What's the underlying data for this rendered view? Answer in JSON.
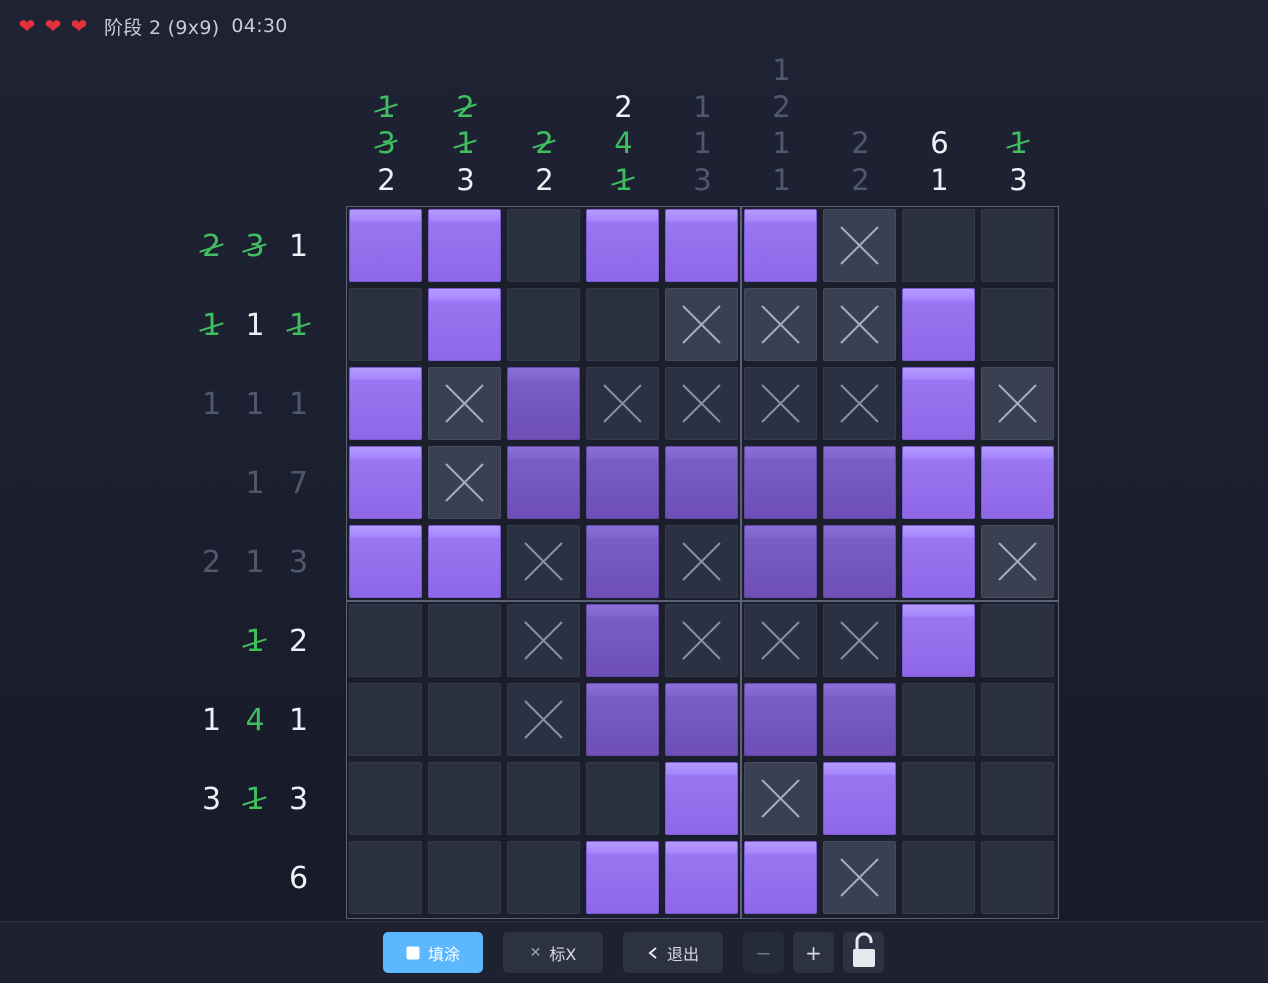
{
  "header": {
    "lives": 3,
    "stage_label": "阶段 2 (9x9)",
    "timer": "04:30"
  },
  "colors": {
    "accent": "#5bb8ff",
    "fill": "#9a76f2",
    "heart": "#e5313b",
    "done_clue": "#3fbf5f"
  },
  "col_clues": [
    [
      {
        "v": "1",
        "s": "done"
      },
      {
        "v": "3",
        "s": "done"
      },
      {
        "v": "2",
        "s": "active"
      }
    ],
    [
      {
        "v": "2",
        "s": "done"
      },
      {
        "v": "1",
        "s": "done"
      },
      {
        "v": "3",
        "s": "active"
      }
    ],
    [
      {
        "v": "2",
        "s": "done"
      },
      {
        "v": "2",
        "s": "active"
      }
    ],
    [
      {
        "v": "2",
        "s": "active"
      },
      {
        "v": "4",
        "s": "green"
      },
      {
        "v": "1",
        "s": "done"
      }
    ],
    [
      {
        "v": "1",
        "s": "dim"
      },
      {
        "v": "1",
        "s": "dim"
      },
      {
        "v": "3",
        "s": "dim"
      }
    ],
    [
      {
        "v": "1",
        "s": "dim"
      },
      {
        "v": "2",
        "s": "dim"
      },
      {
        "v": "1",
        "s": "dim"
      },
      {
        "v": "1",
        "s": "dim"
      }
    ],
    [
      {
        "v": "2",
        "s": "dim"
      },
      {
        "v": "2",
        "s": "dim"
      }
    ],
    [
      {
        "v": "6",
        "s": "active"
      },
      {
        "v": "1",
        "s": "active"
      }
    ],
    [
      {
        "v": "1",
        "s": "done"
      },
      {
        "v": "3",
        "s": "active"
      }
    ]
  ],
  "row_clues": [
    [
      {
        "v": "2",
        "s": "done"
      },
      {
        "v": "3",
        "s": "done"
      },
      {
        "v": "1",
        "s": "active"
      }
    ],
    [
      {
        "v": "1",
        "s": "done"
      },
      {
        "v": "1",
        "s": "active"
      },
      {
        "v": "1",
        "s": "done"
      }
    ],
    [
      {
        "v": "1",
        "s": "dim"
      },
      {
        "v": "1",
        "s": "dim"
      },
      {
        "v": "1",
        "s": "dim"
      }
    ],
    [
      {
        "v": "1",
        "s": "dim"
      },
      {
        "v": "7",
        "s": "dim"
      }
    ],
    [
      {
        "v": "2",
        "s": "dim"
      },
      {
        "v": "1",
        "s": "dim"
      },
      {
        "v": "3",
        "s": "dim"
      }
    ],
    [
      {
        "v": "1",
        "s": "done"
      },
      {
        "v": "2",
        "s": "active"
      }
    ],
    [
      {
        "v": "1",
        "s": "active"
      },
      {
        "v": "4",
        "s": "green"
      },
      {
        "v": "1",
        "s": "active"
      }
    ],
    [
      {
        "v": "3",
        "s": "active"
      },
      {
        "v": "1",
        "s": "done"
      },
      {
        "v": "3",
        "s": "active"
      }
    ],
    [
      {
        "v": "6",
        "s": "active"
      }
    ]
  ],
  "grid": [
    [
      "F",
      "F",
      "E",
      "F",
      "F",
      "F",
      "X",
      "E",
      "E"
    ],
    [
      "E",
      "F",
      "E",
      "E",
      "X",
      "X",
      "X",
      "F",
      "E"
    ],
    [
      "F",
      "X",
      "D",
      "x",
      "x",
      "x",
      "x",
      "F",
      "X"
    ],
    [
      "F",
      "X",
      "D",
      "D",
      "D",
      "D",
      "D",
      "F",
      "F"
    ],
    [
      "F",
      "F",
      "x",
      "D",
      "x",
      "D",
      "D",
      "F",
      "X"
    ],
    [
      "E",
      "E",
      "x",
      "D",
      "x",
      "x",
      "x",
      "F",
      "E"
    ],
    [
      "E",
      "E",
      "x",
      "D",
      "D",
      "D",
      "D",
      "E",
      "E"
    ],
    [
      "E",
      "E",
      "E",
      "E",
      "F",
      "X",
      "F",
      "E",
      "E"
    ],
    [
      "E",
      "E",
      "E",
      "F",
      "F",
      "F",
      "X",
      "E",
      "E"
    ]
  ],
  "toolbar": {
    "fill_label": "填涂",
    "mark_label": "标X",
    "exit_label": "退出",
    "zoom_out": "−",
    "zoom_in": "+"
  }
}
